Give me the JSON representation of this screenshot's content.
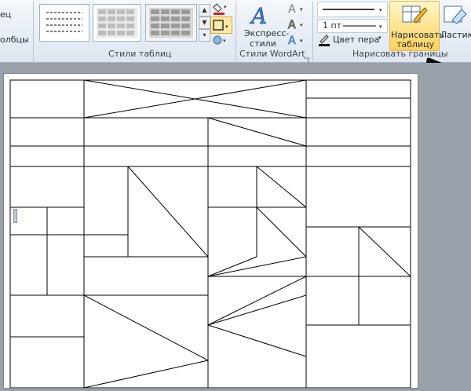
{
  "ribbon": {
    "left_partial_top": "ец",
    "left_partial_bottom": "олбцы",
    "group_table_styles": "Стили таблиц",
    "group_wordart_styles": "Стили WordArt",
    "group_draw_borders": "Нарисовать границы",
    "express_styles_line1": "Экспресс-",
    "express_styles_line2": "стили",
    "pen_weight": "1 пт",
    "pen_color": "Цвет пера",
    "draw_table_line1": "Нарисовать",
    "draw_table_line2": "таблицу",
    "eraser": "Ластик"
  },
  "colors": {
    "accent_highlight": "#ffd15a",
    "page_background": "#ffffff",
    "workspace": "#9aa1ab"
  }
}
